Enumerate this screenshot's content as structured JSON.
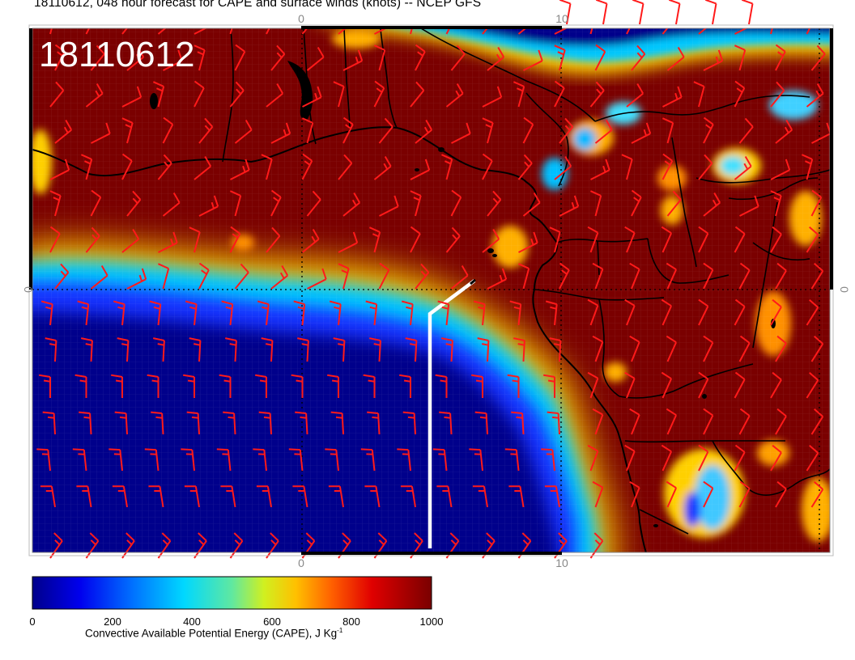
{
  "title": "18110612, 048 hour forecast for CAPE and surface winds (knots) -- NCEP GFS",
  "stamp": "18110612",
  "map": {
    "lon_labels_top": [
      "0",
      "10"
    ],
    "lon_labels_bottom": [
      "0",
      "10"
    ],
    "lat_labels_left": [
      "0"
    ],
    "lat_labels_right": [
      "0"
    ],
    "wind_barb_color": "#ff1a1a",
    "route_color": "#ffffff",
    "coast_color": "#000000"
  },
  "colorbar": {
    "ticks": [
      "0",
      "200",
      "400",
      "600",
      "800",
      "1000"
    ],
    "label": "Convective Available Potential Energy (CAPE), J Kg",
    "label_exp": "-1",
    "colors": [
      "#00008b",
      "#0000ff",
      "#0080ff",
      "#00d0ff",
      "#40e0c0",
      "#c0ff40",
      "#ffd000",
      "#ff8000",
      "#ff2000",
      "#c00000",
      "#800000"
    ]
  }
}
